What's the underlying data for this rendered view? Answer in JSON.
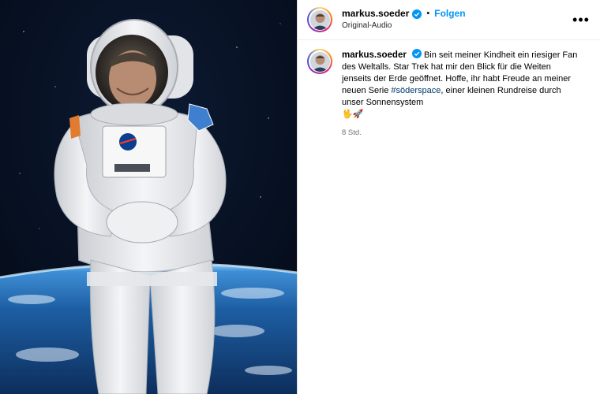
{
  "header": {
    "username": "markus.soeder",
    "dot": "•",
    "follow_label": "Folgen",
    "audio_label": "Original-Audio",
    "more_label": "•••"
  },
  "caption": {
    "username": "markus.soeder",
    "text_before": "Bin seit meiner Kindheit ein riesiger Fan des Weltalls. Star Trek hat mir den Blick für die Weiten jenseits der Erde geöffnet. Hoffe, ihr habt Freude an meiner neuen Serie",
    "hashtag": "#söderspace",
    "text_after": ", einer kleinen Rundreise durch unser Sonnensystem",
    "emojis": "🖖🚀",
    "time": "8 Std."
  },
  "colors": {
    "follow": "#0095f6",
    "hashtag": "#00376b",
    "verified": "#0095f6",
    "meta_text": "#737373"
  },
  "icons": {
    "verified": "verified-badge-icon",
    "more": "more-options-icon"
  }
}
